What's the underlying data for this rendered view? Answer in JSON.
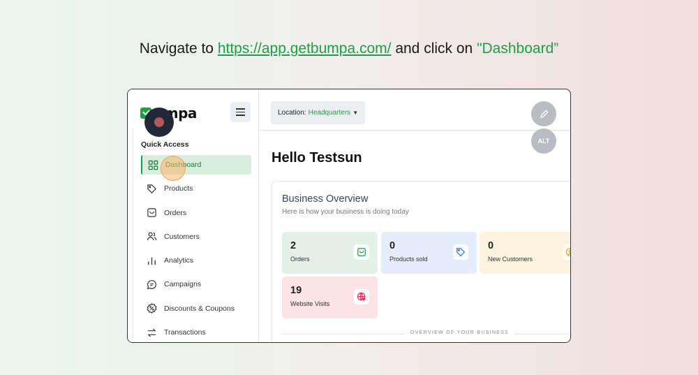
{
  "instruction": {
    "prefix": "Navigate to ",
    "url": "https://app.getbumpa.com/",
    "middle": " and click on ",
    "target": "\"Dashboard”"
  },
  "app": {
    "logo_text": "umpa",
    "quick_access_title": "Quick Access",
    "nav": [
      {
        "label": "Dashboard",
        "icon": "grid-icon",
        "active": true
      },
      {
        "label": "Products",
        "icon": "tag-icon"
      },
      {
        "label": "Orders",
        "icon": "bag-icon"
      },
      {
        "label": "Customers",
        "icon": "users-icon"
      },
      {
        "label": "Analytics",
        "icon": "bar-chart-icon"
      },
      {
        "label": "Campaigns",
        "icon": "chat-icon"
      },
      {
        "label": "Discounts & Coupons",
        "icon": "percent-badge-icon"
      },
      {
        "label": "Transactions",
        "icon": "transfer-icon"
      }
    ]
  },
  "topbar": {
    "location_label": "Location:",
    "location_value": "Headquarters",
    "alt_label": "ALT"
  },
  "main": {
    "greeting": "Hello Testsun",
    "overview_title": "Business Overview",
    "overview_subtitle": "Here is how your business is doing today",
    "stats": [
      {
        "value": "2",
        "label": "Orders",
        "icon": "bag-icon",
        "color": "#1e9e46"
      },
      {
        "value": "0",
        "label": "Products sold",
        "icon": "tag-icon",
        "color": "#2b6fd6"
      },
      {
        "value": "0",
        "label": "New Customers",
        "icon": "user-circle-icon",
        "color": "#e0a800"
      },
      {
        "value": "19",
        "label": "Website Visits",
        "icon": "globe-cursor-icon",
        "color": "#d63352"
      }
    ],
    "caption": "OVERVIEW OF YOUR BUSINESS"
  },
  "colors": {
    "accent": "#1e9e46",
    "recording_dot": "#1f2937"
  }
}
